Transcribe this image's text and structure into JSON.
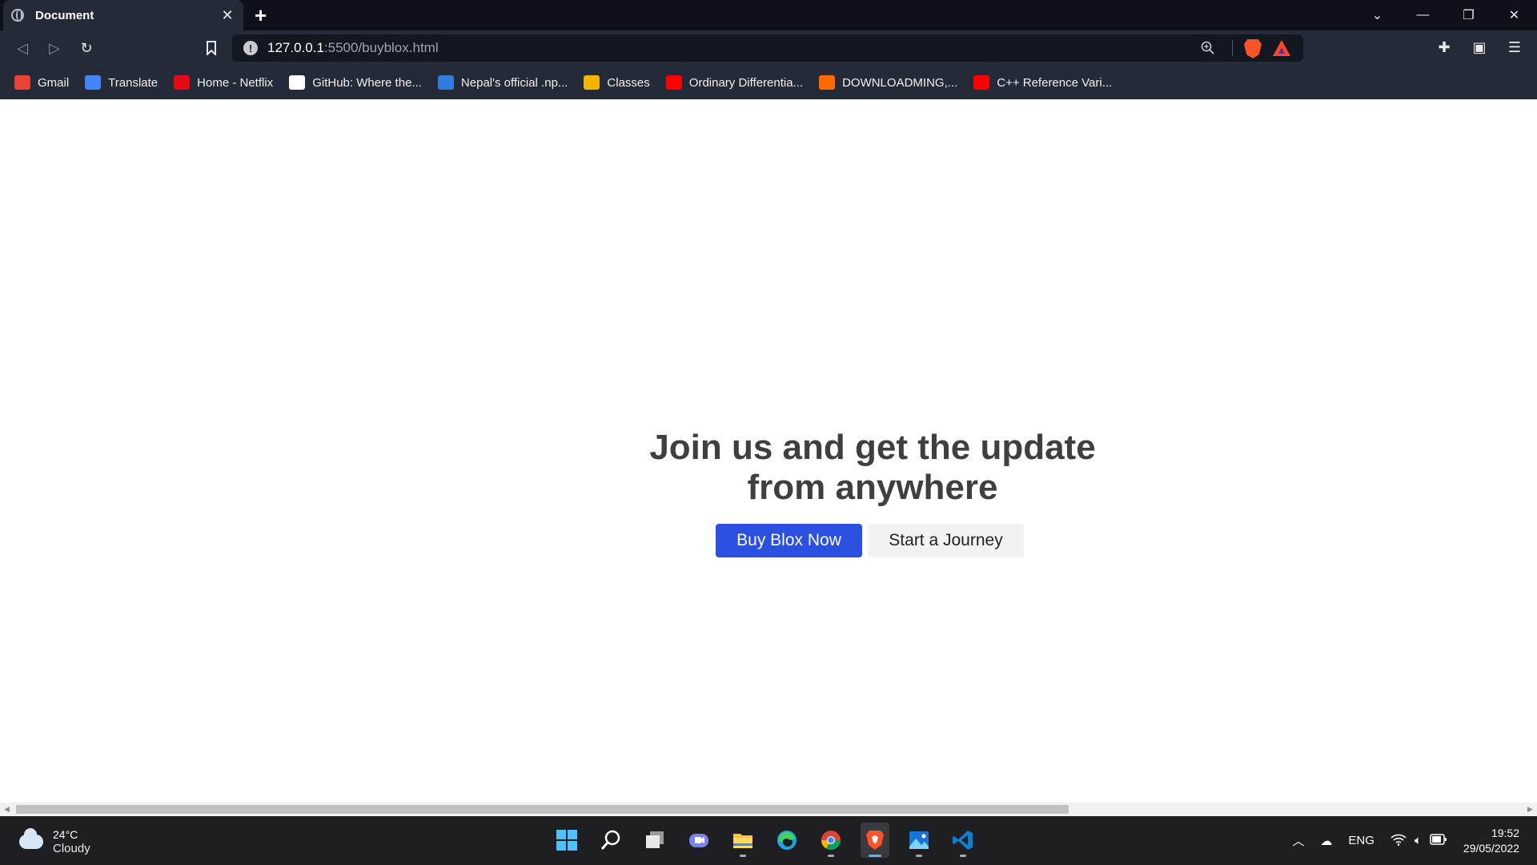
{
  "browser": {
    "tab_title": "Document",
    "url_host": "127.0.0.1",
    "url_rest": ":5500/buyblox.html",
    "bookmarks": [
      {
        "label": "Gmail",
        "icon": "gmail-icon",
        "color": "#ea4335"
      },
      {
        "label": "Translate",
        "icon": "translate-icon",
        "color": "#4285f4"
      },
      {
        "label": "Home - Netflix",
        "icon": "netflix-icon",
        "color": "#e50914"
      },
      {
        "label": "GitHub: Where the...",
        "icon": "github-icon",
        "color": "#ffffff"
      },
      {
        "label": "Nepal's official .np...",
        "icon": "np-icon",
        "color": "#2f7de1"
      },
      {
        "label": "Classes",
        "icon": "classroom-icon",
        "color": "#f4b400"
      },
      {
        "label": "Ordinary Differentia...",
        "icon": "youtube-icon",
        "color": "#ff0000"
      },
      {
        "label": "DOWNLOADMING,...",
        "icon": "d-icon",
        "color": "#ff6a00"
      },
      {
        "label": "C++ Reference Vari...",
        "icon": "youtube-icon",
        "color": "#ff0000"
      }
    ]
  },
  "page": {
    "heading": "Join us and get the update from anywhere",
    "primary_button": "Buy Blox Now",
    "secondary_button": "Start a Journey",
    "primary_color": "#2b4fe0"
  },
  "taskbar": {
    "weather_temp": "24°C",
    "weather_cond": "Cloudy",
    "language": "ENG",
    "time": "19:52",
    "date": "29/05/2022"
  }
}
